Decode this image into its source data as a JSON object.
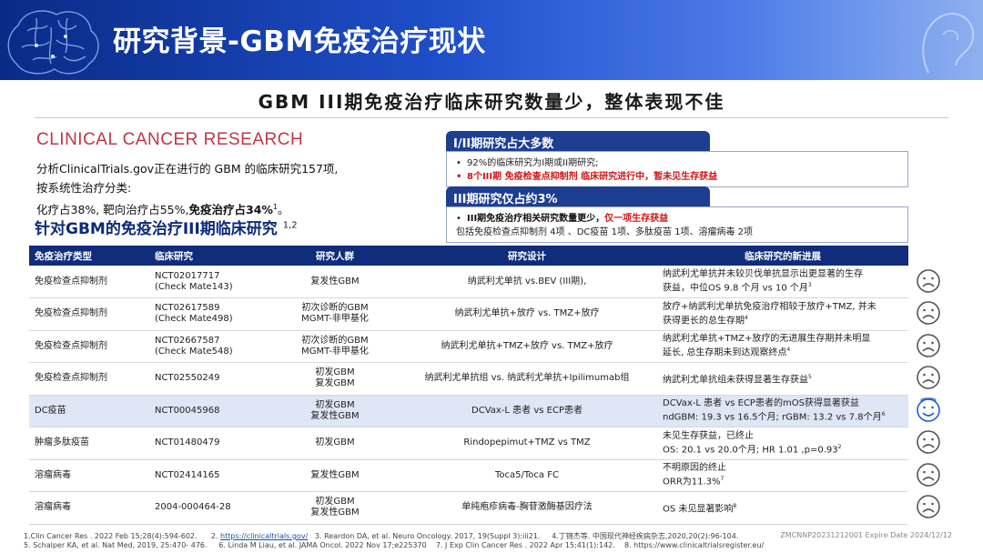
{
  "header": {
    "title": "研究背景-GBM免疫治疗现状"
  },
  "subheading": "GBM III期免疫治疗临床研究数量少，整体表现不佳",
  "journal": "CLINICAL CANCER RESEARCH",
  "intro": {
    "line1": "分析ClinicalTrials.gov正在进行的 GBM 的临床研究157项,",
    "line2": "按系统性治疗分类:",
    "line3_a": "化疗占38%,   靶向治疗占55%,",
    "line3_b": "免疫治疗占34%",
    "line3_sup": "1",
    "line3_c": "。"
  },
  "bigline": {
    "text": "针对GBM的免疫治疗III期临床研究",
    "sup": "1,2"
  },
  "box1": {
    "title": "I/II期研究占大多数",
    "item1": "92%的临床研究为I期或II期研究;",
    "item2": "8个III期 免疫检查点抑制剂 临床研究进行中，暂未见生存获益"
  },
  "box2": {
    "title": "III期研究仅占约3%",
    "item1_a": "III期免疫治疗相关研究数量更少，",
    "item1_b": "仅一项生存获益",
    "item2": "包括免疫检查点抑制剂  4项 、DC疫苗 1项、多肽疫苗 1项、溶瘤病毒 2项"
  },
  "table": {
    "headers": [
      "免疫治疗类型",
      "临床研究",
      "研究人群",
      "研究设计",
      "临床研究的新进展"
    ],
    "rows": [
      {
        "type": "免疫检查点抑制剂",
        "trial1": "NCT02017717",
        "trial2": "(Check Mate143)",
        "pop1": "复发性GBM",
        "pop2": "",
        "design": "纳武利尤单抗 vs.BEV (III期),",
        "prog1": "纳武利尤单抗并未较贝伐单抗显示出更显著的生存",
        "prog2": "获益，中位OS 9.8 个月 vs 10 个月",
        "ref": "3",
        "face": "sad"
      },
      {
        "type": "免疫检查点抑制剂",
        "trial1": "NCT02617589",
        "trial2": "(Check Mate498)",
        "pop1": "初次诊断的GBM",
        "pop2": "MGMT-非甲基化",
        "design": "纳武利尤单抗+放疗 vs. TMZ+放疗",
        "prog1": "放疗+纳武利尤单抗免疫治疗相较于放疗+TMZ, 并未",
        "prog2": "获得更长的总生存期",
        "ref": "4",
        "face": "sad"
      },
      {
        "type": "免疫检查点抑制剂",
        "trial1": "NCT02667587",
        "trial2": "(Check Mate548)",
        "pop1": "初次诊断的GBM",
        "pop2": "MGMT-非甲基化",
        "design": "纳武利尤单抗+TMZ+放疗 vs. TMZ+放疗",
        "prog1": "纳武利尤单抗+TMZ+放疗的无进展生存期并未明显",
        "prog2": "延长, 总生存期未到达观察终点",
        "ref": "4",
        "face": "sad"
      },
      {
        "type": "免疫检查点抑制剂",
        "trial1": "NCT02550249",
        "trial2": "",
        "pop1": "初发GBM",
        "pop2": "复发GBM",
        "design": "纳武利尤单抗组 vs. 纳武利尤单抗+Ipilimumab组",
        "prog1": "纳武利尤单抗组未获得显著生存获益",
        "prog2": "",
        "ref": "5",
        "face": "sad"
      },
      {
        "type": "DC疫苗",
        "trial1": "NCT00045968",
        "trial2": "",
        "pop1": "初发GBM",
        "pop2": "复发性GBM",
        "design": "DCVax-L 患者 vs ECP患者",
        "prog1": "DCVax-L 患者 vs ECP患者的mOS获得显著获益",
        "prog2": "ndGBM: 19.3 vs 16.5个月; rGBM: 13.2 vs 7.8个月",
        "ref": "6",
        "face": "happy"
      },
      {
        "type": "肿瘤多肽疫苗",
        "trial1": "NCT01480479",
        "trial2": "",
        "pop1": "初发GBM",
        "pop2": "",
        "design": "Rindopepimut+TMZ vs TMZ",
        "prog1": "未见生存获益，已终止",
        "prog2": "OS: 20.1 vs 20.0个月; HR 1.01 ,p=0.93",
        "ref": "2",
        "face": "sad"
      },
      {
        "type": "溶瘤病毒",
        "trial1": "NCT02414165",
        "trial2": "",
        "pop1": "复发性GBM",
        "pop2": "",
        "design": "Toca5/Toca FC",
        "prog1": "不明原因的终止",
        "prog2": "ORR为11.3%",
        "ref": "7",
        "face": "sad"
      },
      {
        "type": "溶瘤病毒",
        "trial1": "2004-000464-28",
        "trial2": "",
        "pop1": "初发GBM",
        "pop2": "复发性GBM",
        "design": "单纯疱疹病毒-胸苷激酶基因疗法",
        "prog1": "OS 未见显著影响",
        "prog2": "",
        "ref": "8",
        "face": "sad"
      }
    ]
  },
  "footnotes": {
    "line1_a": "1.Clin Cancer Res . 2022 Feb 15;28(4):594-602.",
    "line1_link": "https://clinicaltrials.gov/",
    "line1_b": "2.",
    "line1_c": "3. Reardon DA, et al. Neuro Oncology. 2017, 19(Suppl 3):iii21.",
    "line1_d": "4.丁锦杰等. 中国现代神经疾病杂志,2020,20(2):96-104.",
    "line2_a": "5. Schalper KA, et al. Nat Med, 2019, 25:470- 476.",
    "line2_b": "6. Linda M Liau, et al. JAMA Oncol. 2022 Nov 17;e225370",
    "line2_c": "7. J Exp Clin Cancer Res . 2022 Apr 15;41(1):142.",
    "line2_d": "8. https://www.clinicaltrialsregister.eu/",
    "code": "ZMCNNP20231212001 Expire Date 2024/12/12"
  },
  "colors": {
    "navy": "#0f2d7a",
    "red": "#d21414",
    "journal": "#c0344a",
    "highlight": "#dfe6f5"
  },
  "icons": {
    "sad": "sad-face-icon",
    "happy": "happy-face-icon"
  }
}
